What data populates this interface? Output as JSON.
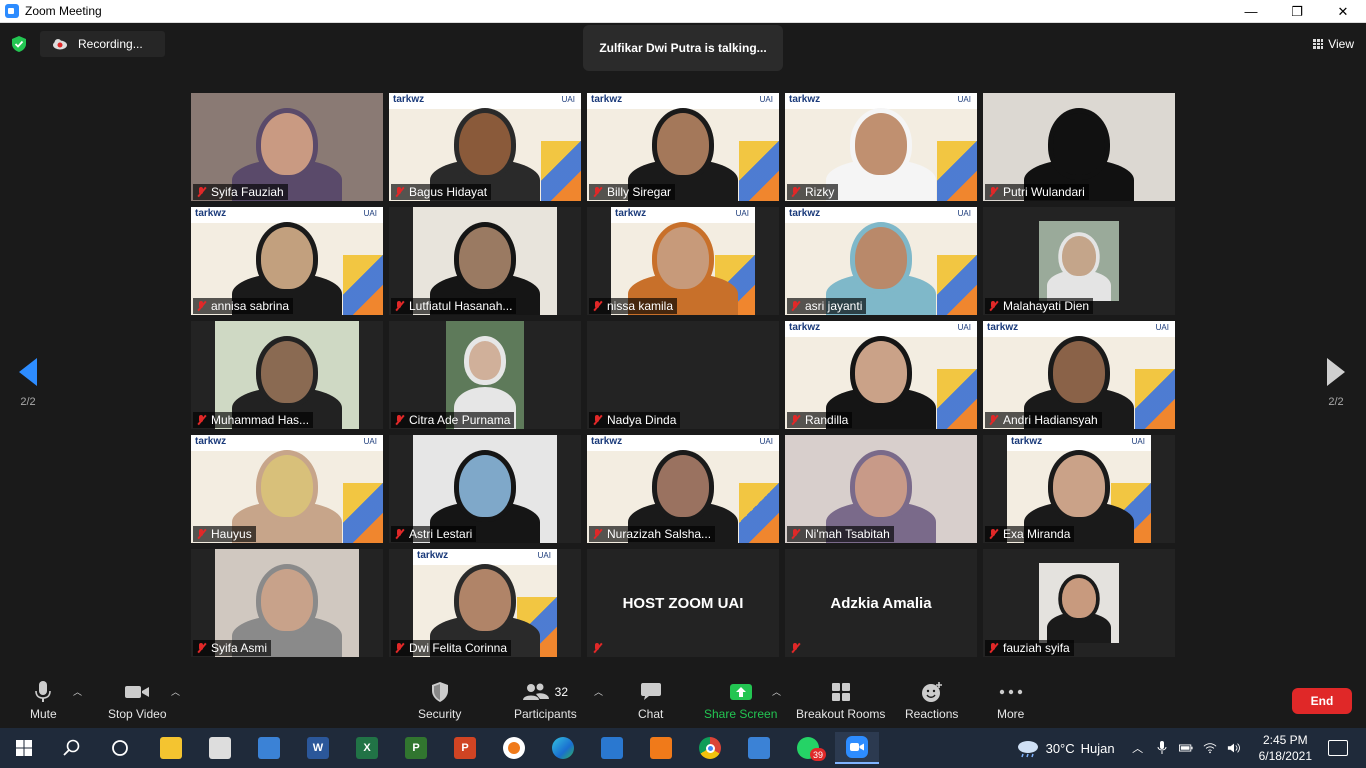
{
  "window": {
    "title": "Zoom Meeting",
    "minimize": "—",
    "maximize": "❐",
    "close": "✕"
  },
  "top": {
    "recording_label": "Recording...",
    "talking": "Zulfikar Dwi Putra is talking...",
    "view_label": "View"
  },
  "pagination": {
    "left": "2/2",
    "right": "2/2"
  },
  "participants": [
    {
      "name": "Syifa Fauziah",
      "bg": "#8a7a74",
      "skin": "#c99a82",
      "hijab": "#5a4a6a",
      "style": "full",
      "branded": false
    },
    {
      "name": "Bagus Hidayat",
      "bg": "#f3ede1",
      "skin": "#8a5a3a",
      "hijab": "#2a2a2a",
      "style": "full",
      "branded": true
    },
    {
      "name": "Billy Siregar",
      "bg": "#f3ede1",
      "skin": "#a4785a",
      "hijab": "#1a1a1a",
      "style": "full",
      "branded": true
    },
    {
      "name": "Rizky",
      "bg": "#f3ede1",
      "skin": "#c09070",
      "hijab": "#f5f5f5",
      "style": "full",
      "branded": true
    },
    {
      "name": "Putri Wulandari",
      "bg": "#dcd8d2",
      "skin": "#111111",
      "hijab": "#111111",
      "style": "full",
      "branded": false
    },
    {
      "name": "annisa sabrina",
      "bg": "#f3ede1",
      "skin": "#c2a07e",
      "hijab": "#1a1a1a",
      "style": "full",
      "branded": true
    },
    {
      "name": "Lutfiatul Hasanah...",
      "bg": "#e8e4dc",
      "skin": "#9a7a62",
      "hijab": "#151515",
      "style": "center",
      "branded": false
    },
    {
      "name": "nissa kamila",
      "bg": "#f3ede1",
      "skin": "#c79a7a",
      "hijab": "#c8702a",
      "style": "center",
      "branded": true
    },
    {
      "name": "asri jayanti",
      "bg": "#f3ede1",
      "skin": "#b9896a",
      "hijab": "#7fb8c9",
      "style": "full",
      "branded": true
    },
    {
      "name": "Malahayati Dien",
      "bg": "#9aaa9a",
      "skin": "#c4a58a",
      "hijab": "#e4e4e4",
      "style": "small",
      "branded": false
    },
    {
      "name": "Muhammad Has...",
      "bg": "#cfd9c4",
      "skin": "#8a6a52",
      "hijab": "#222222",
      "style": "center",
      "branded": false
    },
    {
      "name": "Citra Ade Purnama",
      "bg": "#5e7a5a",
      "skin": "#d0b09a",
      "hijab": "#e6e6e6",
      "style": "centersmall",
      "branded": false
    },
    {
      "name": "Nadya Dinda",
      "bg": "#232323",
      "skin": "",
      "hijab": "",
      "style": "none",
      "branded": false
    },
    {
      "name": "Randilla",
      "bg": "#f3ede1",
      "skin": "#caa288",
      "hijab": "#151515",
      "style": "full",
      "branded": true
    },
    {
      "name": "Andri Hadiansyah",
      "bg": "#f3ede1",
      "skin": "#8a6248",
      "hijab": "#1a1a1a",
      "style": "full",
      "branded": true
    },
    {
      "name": "Hauyus",
      "bg": "#f3ede1",
      "skin": "#d8c07a",
      "hijab": "#c7a58a",
      "style": "full",
      "branded": true
    },
    {
      "name": "Astri Lestari",
      "bg": "#e6e6e6",
      "skin": "#7fa8c9",
      "hijab": "#151515",
      "style": "center",
      "branded": false
    },
    {
      "name": "Nurazizah Salsha...",
      "bg": "#f3ede1",
      "skin": "#9a7260",
      "hijab": "#1a1a1a",
      "style": "full",
      "branded": true
    },
    {
      "name": "Ni'mah Tsabitah",
      "bg": "#d8cfcc",
      "skin": "#c89a88",
      "hijab": "#7a6a8a",
      "style": "full",
      "branded": false
    },
    {
      "name": "Exa Miranda",
      "bg": "#f3ede1",
      "skin": "#caa288",
      "hijab": "#1a1a1a",
      "style": "center",
      "branded": true
    },
    {
      "name": "Syifa Asmi",
      "bg": "#d0c8c0",
      "skin": "#c8a28a",
      "hijab": "#8a8a8a",
      "style": "center",
      "branded": false
    },
    {
      "name": "Dwi Felita Corinna",
      "bg": "#f3ede1",
      "skin": "#b08468",
      "hijab": "#2a2a2a",
      "style": "center",
      "branded": true
    },
    {
      "name": "",
      "display_name": "HOST ZOOM UAI",
      "bg": "#232323",
      "style": "none",
      "branded": false
    },
    {
      "name": "",
      "display_name": "Adzkia Amalia",
      "bg": "#232323",
      "style": "none",
      "branded": false
    },
    {
      "name": "fauziah syifa",
      "bg": "#e4e2de",
      "skin": "#c89a7e",
      "hijab": "#1a1a1a",
      "style": "small",
      "branded": false
    }
  ],
  "branding": {
    "logo_text": "tarkwz",
    "uai": "UAI"
  },
  "toolbar": {
    "mute": "Mute",
    "stop_video": "Stop Video",
    "security": "Security",
    "participants": "Participants",
    "participants_count": "32",
    "chat": "Chat",
    "share_screen": "Share Screen",
    "breakout_rooms": "Breakout Rooms",
    "reactions": "Reactions",
    "more": "More",
    "end": "End"
  },
  "taskbar": {
    "apps": [
      {
        "id": "start",
        "label": "",
        "color": "#ffffff"
      },
      {
        "id": "search",
        "label": "",
        "color": "#ffffff"
      },
      {
        "id": "task-view",
        "label": "",
        "color": "#ffffff"
      },
      {
        "id": "file-explorer",
        "label": "",
        "color": "#f4c430"
      },
      {
        "id": "store",
        "label": "",
        "color": "#dddddd"
      },
      {
        "id": "mail",
        "label": "",
        "color": "#3b82d6"
      },
      {
        "id": "word",
        "label": "W",
        "color": "#2b579a"
      },
      {
        "id": "excel",
        "label": "X",
        "color": "#217346"
      },
      {
        "id": "project",
        "label": "P",
        "color": "#31752f"
      },
      {
        "id": "powerpoint",
        "label": "P",
        "color": "#d04423"
      },
      {
        "id": "avast",
        "label": "",
        "color": "#f07a1a"
      },
      {
        "id": "edge",
        "label": "",
        "color": "#1aa3c8"
      },
      {
        "id": "movies",
        "label": "",
        "color": "#2a78d0"
      },
      {
        "id": "media-player",
        "label": "",
        "color": "#f07a1a"
      },
      {
        "id": "chrome",
        "label": "",
        "color": "#e6b820"
      },
      {
        "id": "photos",
        "label": "",
        "color": "#3b82d6"
      },
      {
        "id": "whatsapp",
        "label": "",
        "color": "#25d366",
        "badge": "39"
      },
      {
        "id": "zoom",
        "label": "",
        "color": "#2d8cff"
      }
    ],
    "weather_temp": "30°C",
    "weather_text": "Hujan",
    "time": "2:45 PM",
    "date": "6/18/2021"
  }
}
